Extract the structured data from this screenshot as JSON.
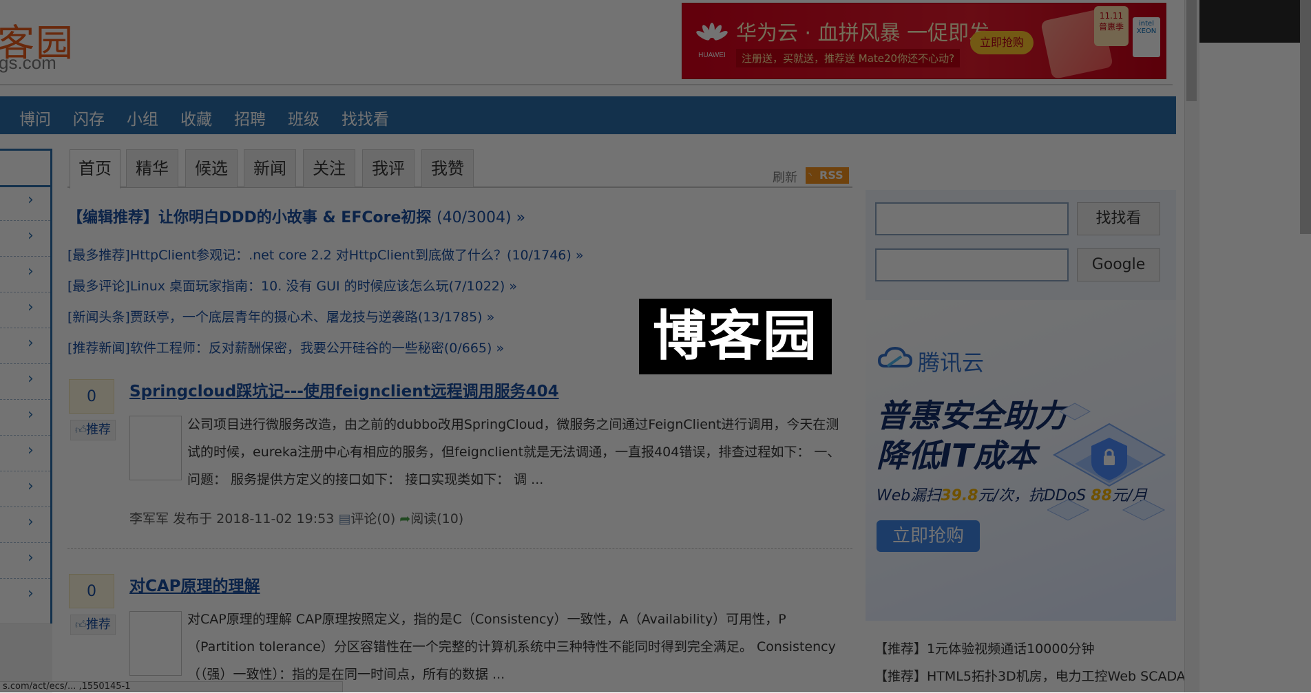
{
  "header": {
    "logo_text": "客园",
    "logo_domain": "gs.com"
  },
  "ad_huawei": {
    "brand": "HUAWEI",
    "title": "华为云 · 血拼风暴 一促即发",
    "sub": "注册送，买就送，推荐送 Mate20你还不心动?",
    "button": "立即抢购",
    "badge": "11.11 普惠季",
    "chip": "intel XEON"
  },
  "nav": {
    "items": [
      "博问",
      "闪存",
      "小组",
      "收藏",
      "招聘",
      "班级",
      "找找看"
    ]
  },
  "tabs": [
    "首页",
    "精华",
    "候选",
    "新闻",
    "关注",
    "我评",
    "我赞"
  ],
  "toolbar": {
    "refresh": "刷新",
    "rss": "RSS"
  },
  "headline": {
    "text": "【编辑推荐】让你明白DDD的小故事 & EFCore初探",
    "count": "(40/3004) »"
  },
  "news": [
    "[最多推荐]HttpClient参观记：.net core 2.2 对HttpClient到底做了什么？(10/1746) »",
    "[最多评论]Linux 桌面玩家指南：10. 没有 GUI 的时候应该怎么玩(7/1022) »",
    "[新闻头条]贾跃亭，一个底层青年的摄心术、屠龙技与逆袭路(13/1785) »",
    "[推荐新闻]软件工程师：反对薪酬保密，我要公开硅谷的一些秘密(0/665) »"
  ],
  "posts": [
    {
      "votes": "0",
      "digg": "推荐",
      "title": "Springcloud踩坑记---使用feignclient远程调用服务404",
      "summary": "公司项目进行微服务改造，由之前的dubbo改用SpringCloud，微服务之间通过FeignClient进行调用，今天在测试的时候，eureka注册中心有相应的服务，但feignclient就是无法调通，一直报404错误，排查过程如下： 一、问题： 服务提供方定义的接口如下： 接口实现类如下： 调 ...",
      "author": "李军军",
      "published": "发布于 2018-11-02 19:53",
      "comments": "评论(0)",
      "reads": "阅读(10)"
    },
    {
      "votes": "0",
      "digg": "推荐",
      "title": "对CAP原理的理解",
      "summary": "对CAP原理的理解 CAP原理按照定义，指的是C（Consistency）一致性，A（Availability）可用性，P（Partition tolerance）分区容错性在一个完整的计算机系统中三种特性不能同时得到完全满足。 Consistency（（强）一致性）：指的是在同一时间点，所有的数据 ..."
    }
  ],
  "search": {
    "zzk_button": "找找看",
    "google_button": "Google"
  },
  "ad_tencent": {
    "brand": "腾讯云",
    "line1": "普惠安全助力",
    "line2": "降低IT成本",
    "price_a": "Web漏扫",
    "price_a_num": "39.8",
    "price_a_unit": "元/次，抗DDoS ",
    "price_b_num": "88",
    "price_b_unit": "元/月",
    "button": "立即抢购"
  },
  "promos": [
    "【推荐】1元体验视频通话10000分钟",
    "【推荐】HTML5拓扑3D机房，电力工控Web SCADA"
  ],
  "status_bar": {
    "url": "s.com/act/ecs/... ,1550145-1"
  },
  "watermark": "博客园",
  "colors": {
    "brand_orange": "#e85b1c",
    "nav_blue": "#2c6da8",
    "link_blue": "#1a4ea1",
    "overlay": "rgba(0,0,0,0.55)"
  }
}
